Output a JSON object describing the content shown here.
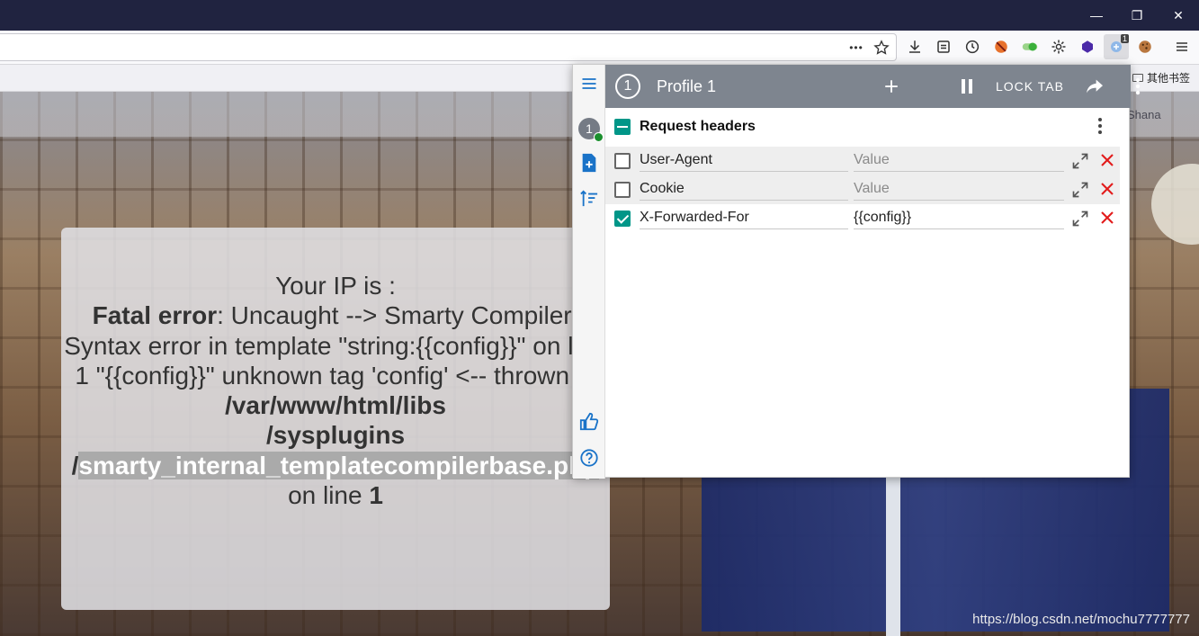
{
  "window": {
    "minimize_glyph": "—",
    "restore_glyph": "❐",
    "close_glyph": "✕"
  },
  "toolbar": {
    "page_actions_glyph": "•••",
    "extension_badge": "1"
  },
  "bookmarks": {
    "other_bookmarks": "其他书签"
  },
  "page": {
    "site_user": "Shana",
    "ip_label": "Your IP is :",
    "error_label": "Fatal error",
    "error_message": ": Uncaught --> Smarty Compiler: Syntax error in template \"string:{{config}}\" on line 1 \"{{config}}\" unknown tag 'config' <-- thrown in ",
    "error_path_1": "/var/www/html/libs",
    "error_path_2": "/sysplugins",
    "error_path_3_prefix": "/",
    "error_path_3_highlight": "smarty_internal_templatecompilerbase.php",
    "on_line_text": "on line ",
    "line_number": "1",
    "watermark": "https://blog.csdn.net/mochu7777777"
  },
  "modheader": {
    "profile_number": "1",
    "profile_title": "Profile 1",
    "lock_tab": "LOCK TAB",
    "section_title": "Request headers",
    "headers": [
      {
        "name": "User-Agent",
        "value": "",
        "placeholder": "Value",
        "enabled": false
      },
      {
        "name": "Cookie",
        "value": "",
        "placeholder": "Value",
        "enabled": false
      },
      {
        "name": "X-Forwarded-For",
        "value": "{{config}}",
        "placeholder": "Value",
        "enabled": true
      }
    ],
    "colors": {
      "header_bg": "#7e858f",
      "accent": "#009688",
      "icon_blue": "#1a73c8",
      "delete_red": "#e21b1b"
    }
  }
}
